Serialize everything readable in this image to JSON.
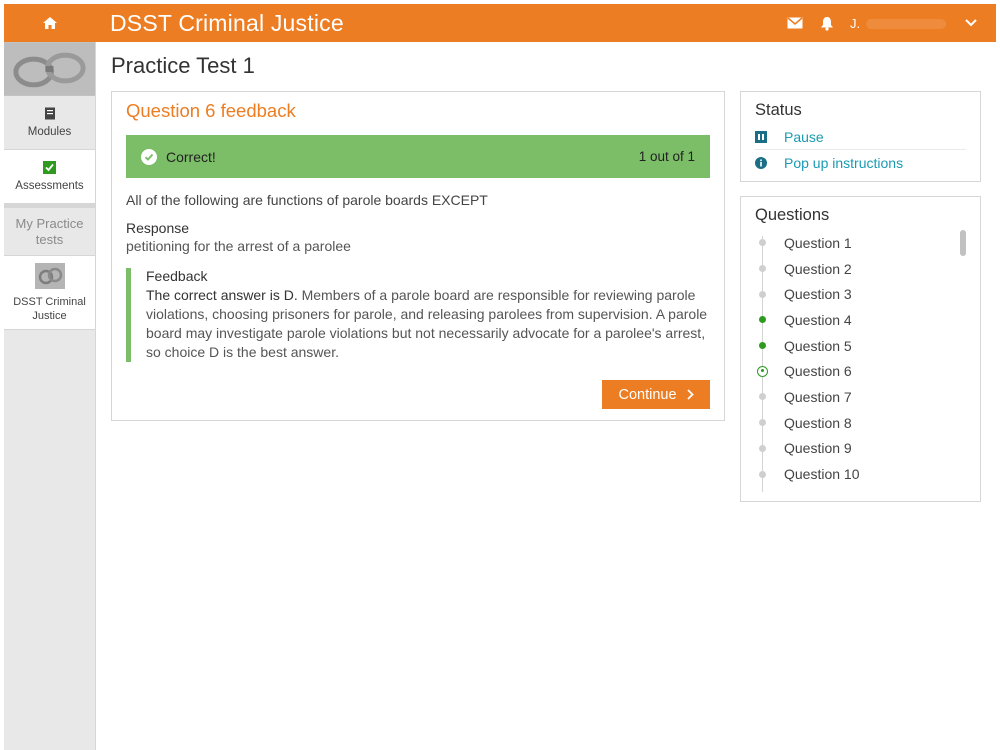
{
  "header": {
    "title": "DSST Criminal Justice",
    "user_initial": "J.",
    "icons": {
      "home": "home-icon",
      "mail": "mail-icon",
      "bell": "bell-icon",
      "menu": "chevron-down-icon"
    }
  },
  "sidebar": {
    "items": [
      {
        "label": "Modules",
        "icon": "book-icon"
      },
      {
        "label": "Assessments",
        "icon": "checkbox-icon"
      }
    ],
    "section_label": "My Practice tests",
    "course_label": "DSST Criminal Justice"
  },
  "page": {
    "title": "Practice Test 1"
  },
  "feedback_card": {
    "title": "Question 6 feedback",
    "result_label": "Correct!",
    "score": "1 out of 1",
    "question_text": "All of the following are functions of parole boards EXCEPT",
    "response_label": "Response",
    "response_value": "petitioning for the arrest of a parolee",
    "feedback_label": "Feedback",
    "feedback_lead": "The correct answer is D.",
    "feedback_body": " Members of a parole board are responsible for reviewing parole violations, choosing prisoners for parole, and releasing parolees from supervision. A parole board may investigate parole violations but not necessarily advocate for a parolee's arrest, so choice D is the best answer.",
    "continue_label": "Continue"
  },
  "status": {
    "title": "Status",
    "pause_label": "Pause",
    "instructions_label": "Pop up instructions"
  },
  "questions": {
    "title": "Questions",
    "items": [
      {
        "label": "Question 1",
        "state": "unanswered"
      },
      {
        "label": "Question 2",
        "state": "unanswered"
      },
      {
        "label": "Question 3",
        "state": "unanswered"
      },
      {
        "label": "Question 4",
        "state": "done"
      },
      {
        "label": "Question 5",
        "state": "done"
      },
      {
        "label": "Question 6",
        "state": "current"
      },
      {
        "label": "Question 7",
        "state": "unanswered"
      },
      {
        "label": "Question 8",
        "state": "unanswered"
      },
      {
        "label": "Question 9",
        "state": "unanswered"
      },
      {
        "label": "Question 10",
        "state": "unanswered"
      }
    ]
  },
  "colors": {
    "accent": "#ed7d22",
    "success": "#7cbd68",
    "link": "#1a9bb3",
    "done_dot": "#2e9a1f"
  }
}
